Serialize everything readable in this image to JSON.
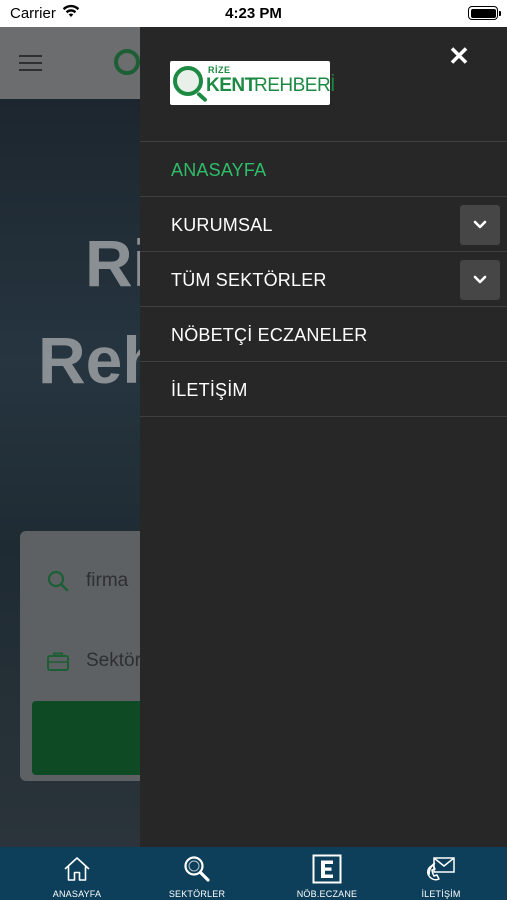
{
  "status_bar": {
    "carrier": "Carrier",
    "time": "4:23 PM"
  },
  "background": {
    "hero_title_line1": "Ri",
    "hero_title_line2": "Reh",
    "search_placeholder": "firma",
    "sector_placeholder": "Sektör"
  },
  "drawer": {
    "logo_small": "RİZE",
    "logo_kent": "KENT",
    "logo_rehber": "REHBERİ",
    "close_symbol": "✕",
    "menu": [
      {
        "label": "ANASAYFA",
        "active": true,
        "expandable": false
      },
      {
        "label": "KURUMSAL",
        "active": false,
        "expandable": true
      },
      {
        "label": "TÜM SEKTÖRLER",
        "active": false,
        "expandable": true
      },
      {
        "label": "NÖBETÇİ ECZANELER",
        "active": false,
        "expandable": false
      },
      {
        "label": "İLETİŞİM",
        "active": false,
        "expandable": false
      }
    ]
  },
  "tabs": [
    {
      "label": "ANASAYFA",
      "icon": "home-icon"
    },
    {
      "label": "SEKTÖRLER",
      "icon": "search-icon"
    },
    {
      "label": "NÖB.ECZANE",
      "icon": "pharmacy-e-icon"
    },
    {
      "label": "İLETİŞİM",
      "icon": "contact-mail-icon"
    }
  ],
  "colors": {
    "active_menu": "#2fbd68",
    "drawer_bg": "#272727",
    "tab_bar_bg": "#0d3f5a",
    "brand_green": "#1d8a43"
  }
}
